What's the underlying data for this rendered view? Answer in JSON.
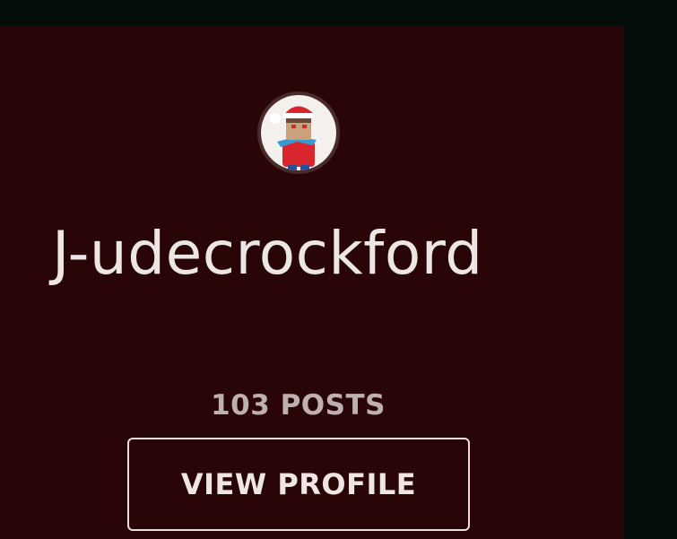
{
  "profile_card": {
    "username": "J-udecrockford",
    "posts_label": "103 POSTS",
    "view_profile_label": "VIEW PROFILE",
    "avatar_icon": "christmas-avatar-icon"
  },
  "colors": {
    "page_background": "#020e07",
    "card_background": "#2a0507",
    "text_primary": "#ece6e4",
    "text_muted": "#bfb0b0"
  }
}
